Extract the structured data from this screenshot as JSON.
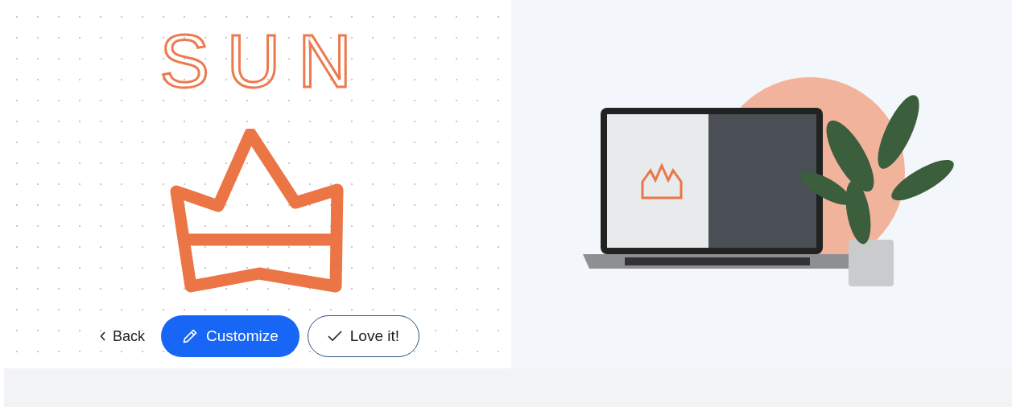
{
  "logo": {
    "text": "SUN"
  },
  "actions": [
    {
      "kind": "back",
      "label": "Back"
    },
    {
      "kind": "primary",
      "label": "Customize"
    },
    {
      "kind": "secondary",
      "label": "Love it!"
    }
  ]
}
